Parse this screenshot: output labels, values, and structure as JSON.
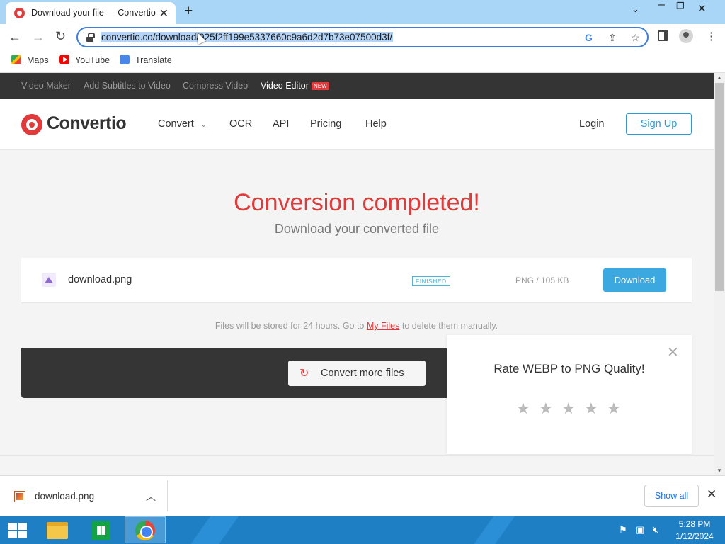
{
  "browser": {
    "tab_title": "Download your file — Convertio",
    "tab_close": "✕",
    "new_tab": "+",
    "url": "convertio.co/download/925f2ff199e5337660c9a6d2d7b73e07500d3f/",
    "bookmarks": [
      {
        "label": "Maps",
        "icon": "maps-icon"
      },
      {
        "label": "YouTube",
        "icon": "youtube-icon"
      },
      {
        "label": "Translate",
        "icon": "translate-icon"
      }
    ]
  },
  "site": {
    "top_links": [
      "Video Maker",
      "Add Subtitles to Video",
      "Compress Video",
      "Video Editor"
    ],
    "new_badge": "NEW",
    "logo": "Convertio",
    "nav": [
      "Convert",
      "OCR",
      "API",
      "Pricing",
      "Help"
    ],
    "login": "Login",
    "signup": "Sign Up"
  },
  "result": {
    "headline": "Conversion completed!",
    "subline": "Download your converted file",
    "file": {
      "name": "download.png",
      "status": "FINISHED",
      "meta": "PNG / 105 KB",
      "download_label": "Download"
    },
    "notice_before": "Files will be stored for 24 hours. Go to ",
    "notice_link": "My Files",
    "notice_after": " to delete them manually.",
    "convert_more": "Convert more files"
  },
  "rating": {
    "title": "Rate WEBP to PNG Quality!",
    "stars": 5
  },
  "download_shelf": {
    "file_name": "download.png",
    "show_all": "Show all"
  },
  "taskbar": {
    "time": "5:28 PM",
    "date": "1/12/2024"
  },
  "colors": {
    "accent_red": "#e03a3a",
    "accent_blue": "#3ba8e0",
    "chrome_frame": "#a9d6f7"
  }
}
